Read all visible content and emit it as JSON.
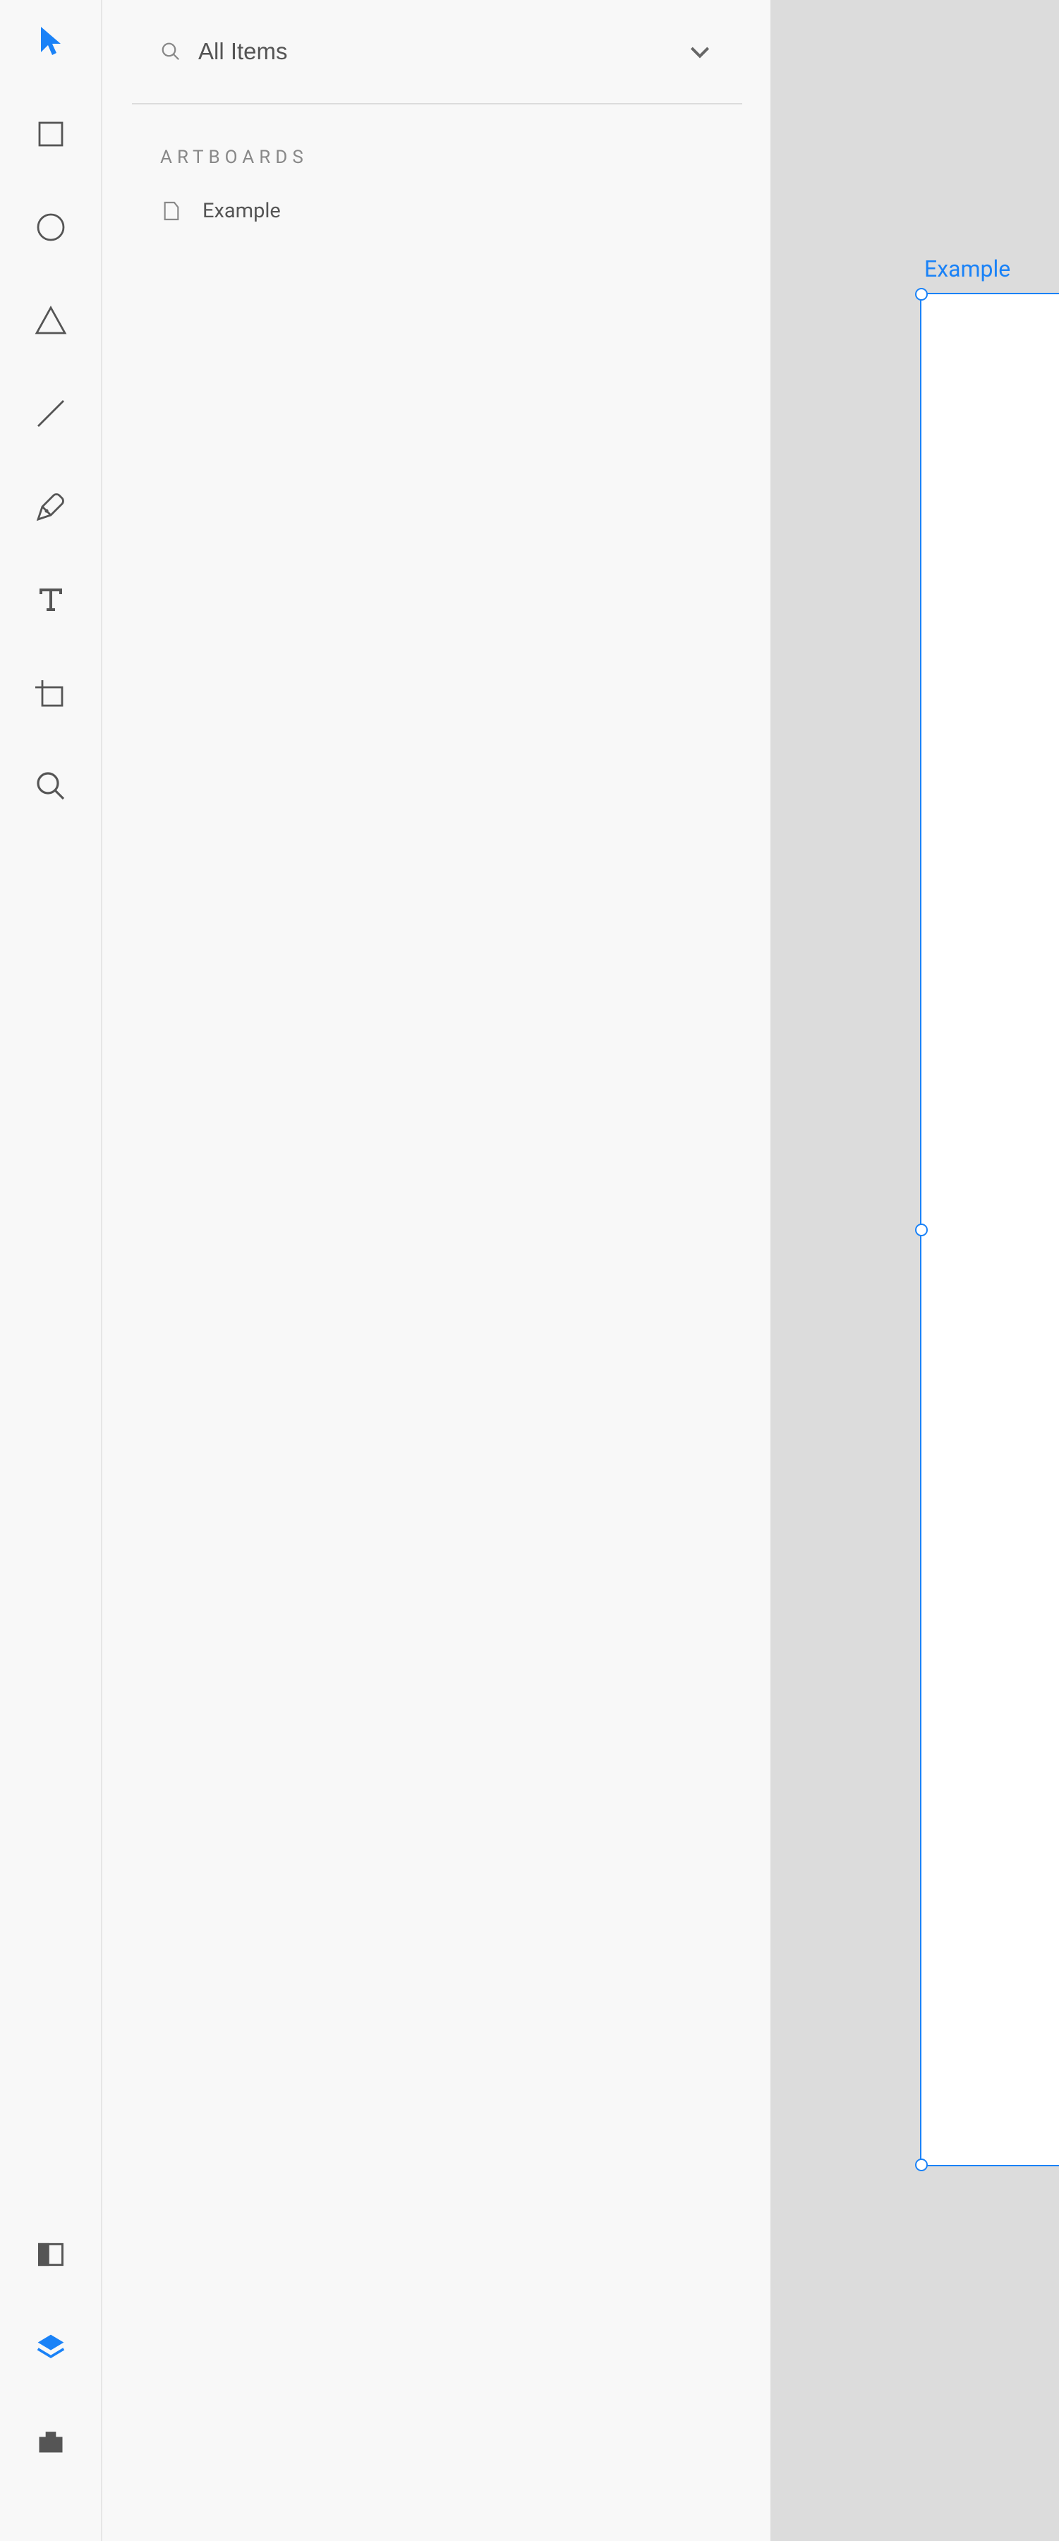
{
  "toolbar": {
    "tools": [
      {
        "name": "select-tool",
        "icon": "pointer",
        "active": true
      },
      {
        "name": "rectangle-tool",
        "icon": "rectangle",
        "active": false
      },
      {
        "name": "ellipse-tool",
        "icon": "ellipse",
        "active": false
      },
      {
        "name": "polygon-tool",
        "icon": "triangle",
        "active": false
      },
      {
        "name": "line-tool",
        "icon": "line",
        "active": false
      },
      {
        "name": "pen-tool",
        "icon": "pen",
        "active": false
      },
      {
        "name": "text-tool",
        "icon": "text",
        "active": false
      },
      {
        "name": "artboard-tool",
        "icon": "artboard",
        "active": false
      },
      {
        "name": "zoom-tool",
        "icon": "zoom",
        "active": false
      }
    ],
    "bottom": [
      {
        "name": "libraries-tab",
        "icon": "panel",
        "active": false
      },
      {
        "name": "layers-tab",
        "icon": "layers",
        "active": true
      },
      {
        "name": "plugins-tab",
        "icon": "plugin",
        "active": false
      }
    ]
  },
  "layers_panel": {
    "search_label": "All Items",
    "section_header": "ARTBOARDS",
    "items": [
      {
        "label": "Example"
      }
    ]
  },
  "canvas": {
    "artboard_label": "Example",
    "accent_color": "#1a82f7"
  }
}
